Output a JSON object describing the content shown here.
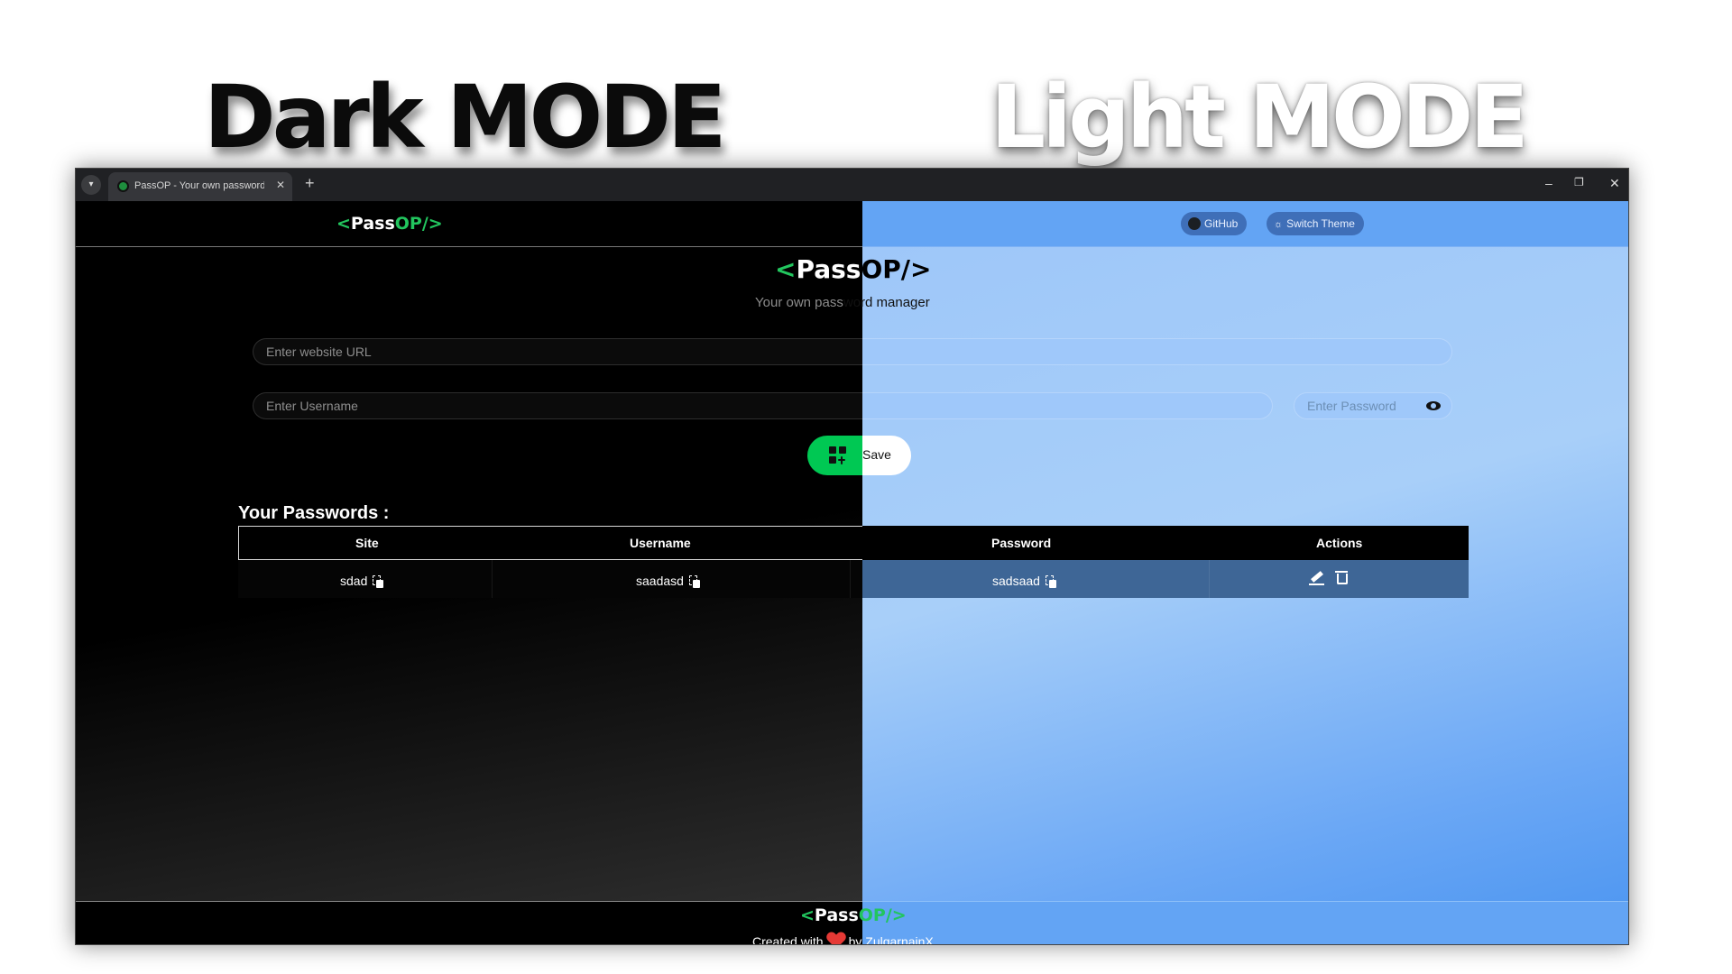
{
  "headlines": {
    "dark": "Dark MODE",
    "light": "Light MODE"
  },
  "browser": {
    "tab_title": "PassOP - Your own password manager",
    "tab_close": "✕",
    "new_tab": "+",
    "controls": {
      "minimize": "–",
      "restore": "❐",
      "close": "✕"
    }
  },
  "brand": {
    "open": "<",
    "pass": "Pass",
    "op": "OP/>"
  },
  "nav": {
    "github_label": "GitHub",
    "theme_label": "Switch Theme"
  },
  "hero": {
    "subtitle_dark": "Your own pass",
    "subtitle_light": "word manager"
  },
  "form": {
    "url_placeholder": "Enter website URL",
    "username_placeholder": "Enter Username",
    "password_placeholder": "Enter Password",
    "save_label_dark": "S",
    "save_label_light": "ave"
  },
  "passwords": {
    "title": "Your Passwords :",
    "columns": [
      "Site",
      "Username",
      "Password",
      "Actions"
    ],
    "rows": [
      {
        "site": "sdad",
        "username": "saadasd",
        "password": "sadsaad"
      }
    ]
  },
  "footer": {
    "created_with": "Created with",
    "by": "by ZulqarnainX"
  },
  "colors": {
    "accent": "#22c55e",
    "save_green": "#00c853",
    "light_nav": "#63a4f4",
    "heart": "#e53935"
  }
}
